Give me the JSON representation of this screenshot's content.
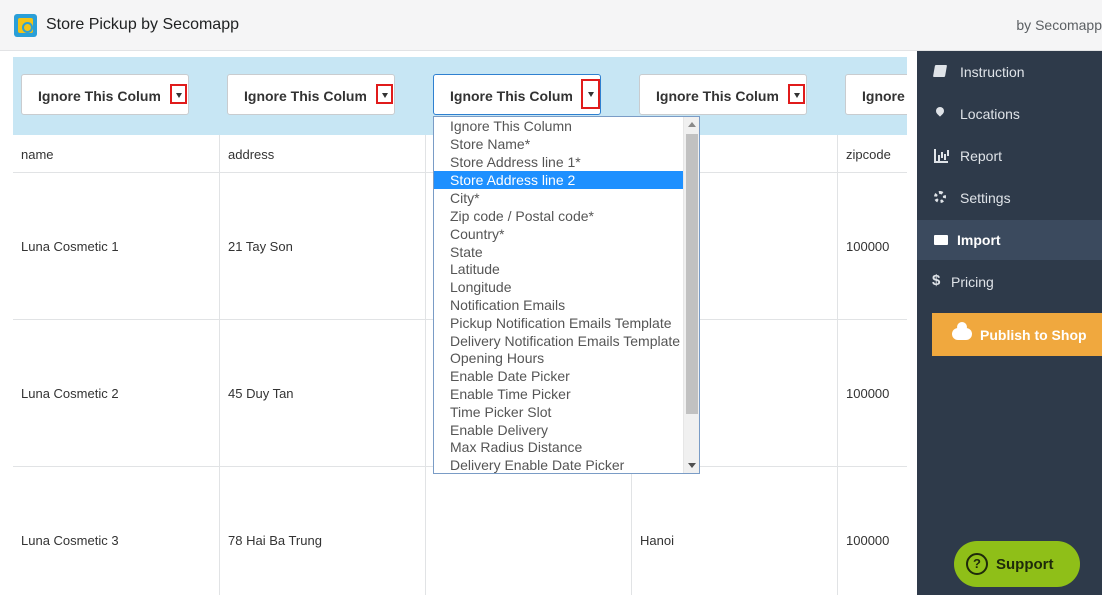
{
  "app": {
    "title": "Store Pickup by Secomapp",
    "by": "by Secomapp"
  },
  "mapping": {
    "selects": [
      {
        "value": "Ignore This Column"
      },
      {
        "value": "Ignore This Column"
      },
      {
        "value": "Ignore This Column"
      },
      {
        "value": "Ignore This Column"
      },
      {
        "value": "Ignore This Column"
      }
    ]
  },
  "table": {
    "headers": [
      "name",
      "address",
      "",
      "",
      "zipcode"
    ],
    "rows": [
      [
        "Luna Cosmetic 1",
        "21 Tay Son",
        "",
        "",
        "100000"
      ],
      [
        "Luna Cosmetic 2",
        "45 Duy Tan",
        "",
        "",
        "100000"
      ],
      [
        "Luna Cosmetic 3",
        "78 Hai Ba Trung",
        "",
        "Hanoi",
        "100000"
      ]
    ]
  },
  "dropdown": {
    "selected_index": 3,
    "options": [
      "Ignore This Column",
      "Store Name*",
      "Store Address line 1*",
      "Store Address line 2",
      "City*",
      "Zip code / Postal code*",
      "Country*",
      "State",
      "Latitude",
      "Longitude",
      "Notification Emails",
      "Pickup Notification Emails Template",
      "Delivery Notification Emails Template",
      "Opening Hours",
      "Enable Date Picker",
      "Enable Time Picker",
      "Time Picker Slot",
      "Enable Delivery",
      "Max Radius Distance",
      "Delivery Enable Date Picker"
    ]
  },
  "sidebar": {
    "items": [
      {
        "label": "Instruction",
        "icon": "book-icon"
      },
      {
        "label": "Locations",
        "icon": "map-marker-icon"
      },
      {
        "label": "Report",
        "icon": "bar-chart-icon"
      },
      {
        "label": "Settings",
        "icon": "gear-icon"
      },
      {
        "label": "Import",
        "icon": "folder-open-icon"
      },
      {
        "label": "Pricing",
        "icon": "dollar-icon"
      }
    ],
    "active_index": 4,
    "publish_label": "Publish to Shop"
  },
  "support": {
    "label": "Support",
    "icon_glyph": "?"
  },
  "colors": {
    "sidebar_bg": "#2e3a4a",
    "publish_bg": "#f0a83e",
    "support_bg": "#8fbf18",
    "mapping_bar_bg": "#c7e6f4",
    "selected_option_bg": "#1e90ff"
  }
}
